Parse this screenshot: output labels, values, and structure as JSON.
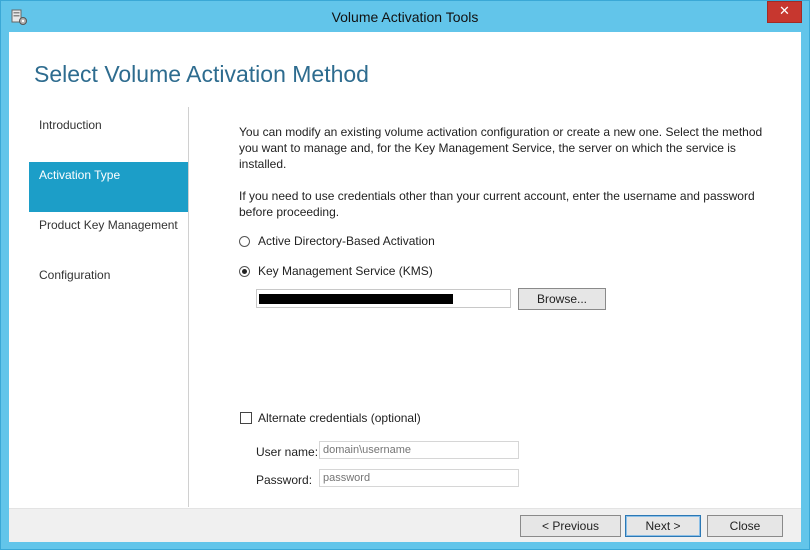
{
  "window": {
    "title": "Volume Activation Tools",
    "close_glyph": "✕",
    "icon": "server-gear-icon"
  },
  "page": {
    "heading": "Select Volume Activation Method"
  },
  "nav": {
    "items": [
      {
        "label": "Introduction",
        "active": false
      },
      {
        "label": "Activation Type",
        "active": true
      },
      {
        "label": "Product Key Management",
        "active": false
      },
      {
        "label": "Configuration",
        "active": false
      }
    ]
  },
  "content": {
    "para1": "You can modify an existing volume activation configuration or create a new one. Select the method you want to manage and, for the Key Management Service, the server on which the service is installed.",
    "para2": "If you need to use credentials other than your current account, enter the username and password before proceeding.",
    "options": {
      "ad_label": "Active Directory-Based Activation",
      "ad_selected": false,
      "kms_label": "Key Management Service (KMS)",
      "kms_selected": true
    },
    "server_value": "",
    "browse_label": "Browse...",
    "alternate_credentials": {
      "label": "Alternate credentials (optional)",
      "checked": false
    },
    "username": {
      "label": "User name:",
      "placeholder": "domain\\username"
    },
    "password": {
      "label": "Password:",
      "placeholder": "password"
    }
  },
  "footer": {
    "previous": "< Previous",
    "next": "Next >",
    "close": "Close"
  }
}
